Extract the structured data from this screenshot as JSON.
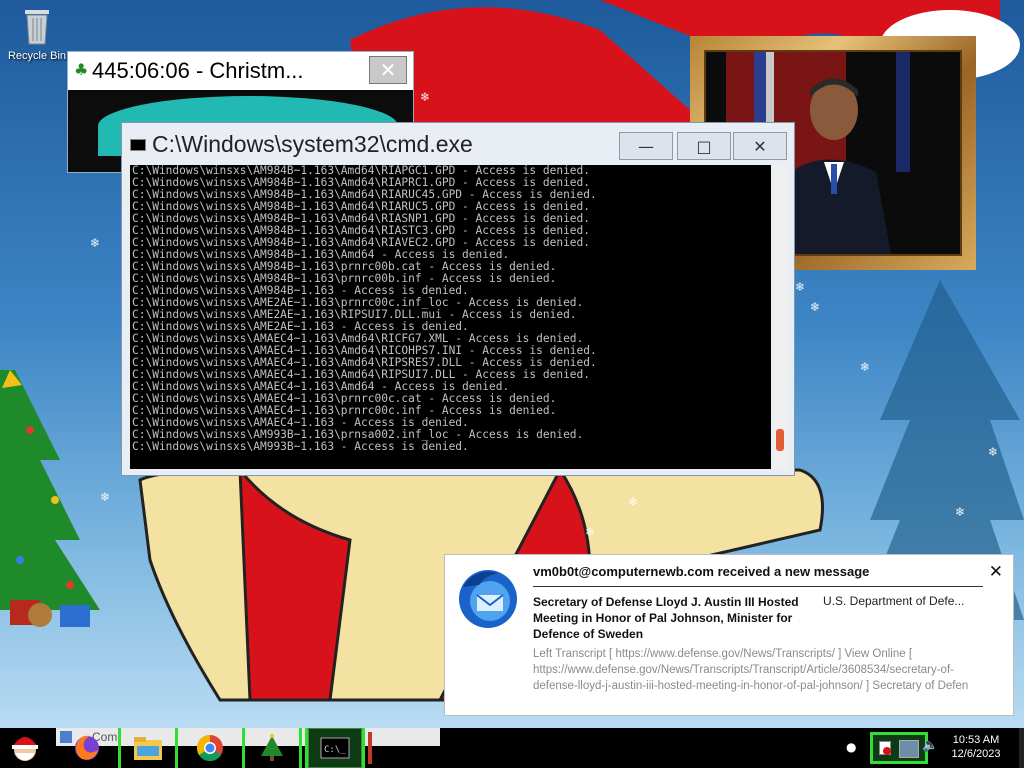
{
  "desktop": {
    "recycle_bin_label": "Recycle Bin"
  },
  "countdown": {
    "title": "445:06:06 - Christm...",
    "close_glyph": "✕"
  },
  "cmd": {
    "title": "C:\\Windows\\system32\\cmd.exe",
    "lines": [
      "C:\\Windows\\winsxs\\AM984B~1.163\\Amd64\\RIAPGC1.GPD - Access is denied.",
      "C:\\Windows\\winsxs\\AM984B~1.163\\Amd64\\RIAPRC1.GPD - Access is denied.",
      "C:\\Windows\\winsxs\\AM984B~1.163\\Amd64\\RIARUC45.GPD - Access is denied.",
      "C:\\Windows\\winsxs\\AM984B~1.163\\Amd64\\RIARUC5.GPD - Access is denied.",
      "C:\\Windows\\winsxs\\AM984B~1.163\\Amd64\\RIASNP1.GPD - Access is denied.",
      "C:\\Windows\\winsxs\\AM984B~1.163\\Amd64\\RIASTC3.GPD - Access is denied.",
      "C:\\Windows\\winsxs\\AM984B~1.163\\Amd64\\RIAVEC2.GPD - Access is denied.",
      "C:\\Windows\\winsxs\\AM984B~1.163\\Amd64 - Access is denied.",
      "C:\\Windows\\winsxs\\AM984B~1.163\\prnrc00b.cat - Access is denied.",
      "C:\\Windows\\winsxs\\AM984B~1.163\\prnrc00b.inf - Access is denied.",
      "C:\\Windows\\winsxs\\AM984B~1.163 - Access is denied.",
      "C:\\Windows\\winsxs\\AME2AE~1.163\\prnrc00c.inf_loc - Access is denied.",
      "C:\\Windows\\winsxs\\AME2AE~1.163\\RIPSUI7.DLL.mui - Access is denied.",
      "C:\\Windows\\winsxs\\AME2AE~1.163 - Access is denied.",
      "C:\\Windows\\winsxs\\AMAEC4~1.163\\Amd64\\RICFG7.XML - Access is denied.",
      "C:\\Windows\\winsxs\\AMAEC4~1.163\\Amd64\\RICOHPS7.INI - Access is denied.",
      "C:\\Windows\\winsxs\\AMAEC4~1.163\\Amd64\\RIPSRES7.DLL - Access is denied.",
      "C:\\Windows\\winsxs\\AMAEC4~1.163\\Amd64\\RIPSUI7.DLL - Access is denied.",
      "C:\\Windows\\winsxs\\AMAEC4~1.163\\Amd64 - Access is denied.",
      "C:\\Windows\\winsxs\\AMAEC4~1.163\\prnrc00c.cat - Access is denied.",
      "C:\\Windows\\winsxs\\AMAEC4~1.163\\prnrc00c.inf - Access is denied.",
      "C:\\Windows\\winsxs\\AMAEC4~1.163 - Access is denied.",
      "C:\\Windows\\winsxs\\AM993B~1.163\\prnsa002.inf_loc - Access is denied.",
      "C:\\Windows\\winsxs\\AM993B~1.163 - Access is denied."
    ],
    "minimize_glyph": "—",
    "maximize_glyph": "□",
    "close_glyph": "✕"
  },
  "notification": {
    "header": "vm0b0t@computernewb.com received a new message",
    "close_glyph": "✕",
    "subject": "Secretary of Defense Lloyd J. Austin III Hosted Meeting in Honor of Pal Johnson, Minister for Defence of Sweden",
    "sender": "U.S. Department of Defe...",
    "preview": "Left Transcript [ https://www.defense.gov/News/Transcripts/ ] View Online [ https://www.defense.gov/News/Transcripts/Transcript/Article/3608534/secretary-of-defense-lloyd-j-austin-iii-hosted-meeting-in-honor-of-pal-johnson/ ] Secretary of Defen"
  },
  "taskbar": {
    "search_text": "Com",
    "clock_time": "10:53 AM",
    "clock_date": "12/6/2023"
  },
  "colors": {
    "console_bg": "#000000",
    "console_text": "#c0c0c0",
    "taskbar_highlight": "#33dd33"
  }
}
